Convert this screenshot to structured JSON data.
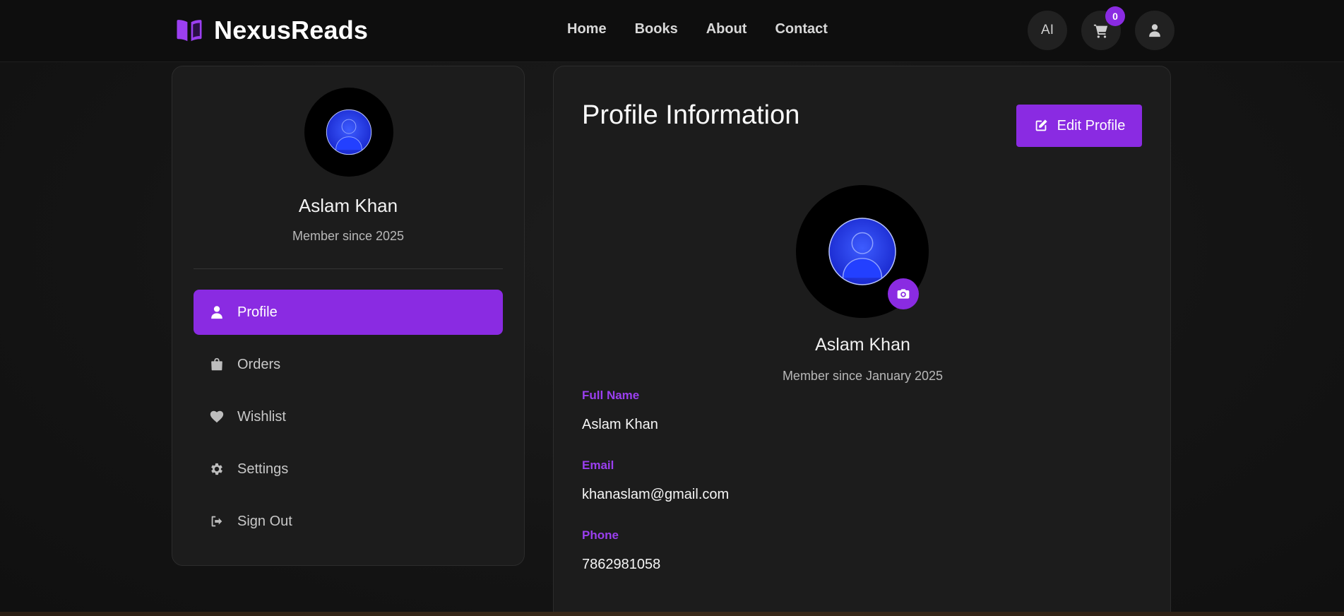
{
  "header": {
    "brand": "NexusReads",
    "nav": [
      "Home",
      "Books",
      "About",
      "Contact"
    ],
    "ai_label": "AI",
    "cart_count": "0"
  },
  "sidebar": {
    "name": "Aslam Khan",
    "member_since": "Member since 2025",
    "menu": [
      {
        "label": "Profile",
        "icon": "user-icon",
        "active": true
      },
      {
        "label": "Orders",
        "icon": "bag-icon"
      },
      {
        "label": "Wishlist",
        "icon": "heart-icon"
      },
      {
        "label": "Settings",
        "icon": "gear-icon"
      },
      {
        "label": "Sign Out",
        "icon": "sign-out-icon"
      }
    ]
  },
  "main": {
    "title": "Profile Information",
    "edit_label": "Edit Profile",
    "name": "Aslam Khan",
    "member_since": "Member since January 2025",
    "fields": [
      {
        "label": "Full Name",
        "value": "Aslam Khan"
      },
      {
        "label": "Email",
        "value": "khanaslam@gmail.com"
      },
      {
        "label": "Phone",
        "value": "7862981058"
      }
    ]
  },
  "colors": {
    "accent": "#8a2be2",
    "label": "#9b3ff0",
    "card": "#1c1c1c",
    "header": "#0e0e0e"
  }
}
